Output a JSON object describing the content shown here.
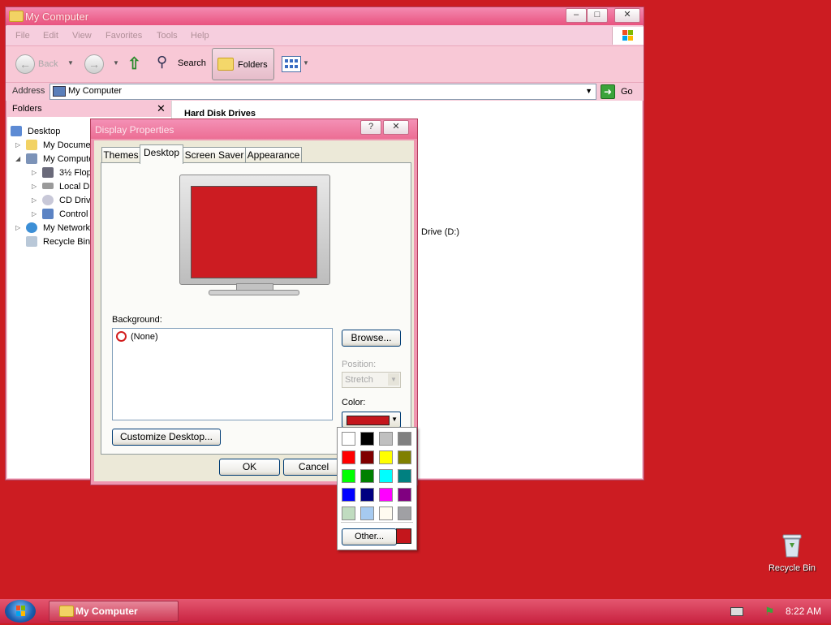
{
  "explorer": {
    "title": "My Computer",
    "menu": [
      "File",
      "Edit",
      "View",
      "Favorites",
      "Tools",
      "Help"
    ],
    "toolbar": {
      "back": "Back",
      "search": "Search",
      "folders": "Folders"
    },
    "address": {
      "label": "Address",
      "value": "My Computer",
      "go": "Go"
    },
    "folders_pane": {
      "title": "Folders",
      "items": [
        {
          "label": "Desktop"
        },
        {
          "label": "My Documents"
        },
        {
          "label": "My Computer"
        },
        {
          "label": "3½ Floppy"
        },
        {
          "label": "Local Disk"
        },
        {
          "label": "CD Drive"
        },
        {
          "label": "Control Panel"
        },
        {
          "label": "My Network Places"
        },
        {
          "label": "Recycle Bin"
        }
      ]
    },
    "main": {
      "section": "Hard Disk Drives",
      "drive_fragment": "Drive (D:)"
    }
  },
  "dialog": {
    "title": "Display Properties",
    "tabs": [
      "Themes",
      "Desktop",
      "Screen Saver",
      "Appearance"
    ],
    "active_tab": "Desktop",
    "monitor_color": "#cc1c22",
    "background_label": "Background:",
    "background_items": [
      "(None)"
    ],
    "browse": "Browse...",
    "position_label": "Position:",
    "position_value": "Stretch",
    "color_label": "Color:",
    "selected_color": "#c4161c",
    "customize": "Customize Desktop...",
    "ok": "OK",
    "cancel": "Cancel"
  },
  "color_picker": {
    "swatches": [
      "#ffffff",
      "#000000",
      "#c0c0c0",
      "#808080",
      "#ff0000",
      "#800000",
      "#ffff00",
      "#808000",
      "#00ff00",
      "#008000",
      "#00ffff",
      "#008080",
      "#0000ff",
      "#000080",
      "#ff00ff",
      "#800080",
      "#c0dcc0",
      "#a6caf0",
      "#fffbf0",
      "#a0a0a4"
    ],
    "other": "Other...",
    "current": "#c4161c"
  },
  "desktop": {
    "recycle_bin": "Recycle Bin",
    "background_color": "#cc1c22"
  },
  "taskbar": {
    "task_label": "My Computer",
    "clock": "8:22 AM"
  }
}
